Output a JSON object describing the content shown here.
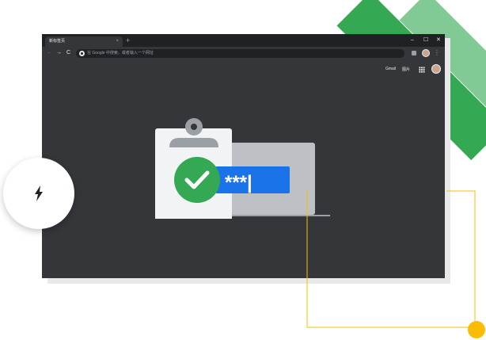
{
  "browser": {
    "tab_title": "新标签页",
    "tab_close_glyph": "×",
    "new_tab_glyph": "+",
    "window_controls": {
      "minimize": "–",
      "maximize": "☐",
      "close": "✕"
    },
    "nav": {
      "back": "←",
      "forward": "→",
      "reload": "C"
    },
    "omnibox_placeholder": "在 Google 中搜索，或者输入一个网址",
    "menu_glyph": "⋮"
  },
  "ntp": {
    "gmail_label": "Gmail",
    "images_label": "图片"
  },
  "illustration": {
    "password_mask": "***|",
    "check_glyph": "✓"
  },
  "colors": {
    "window_bg": "#35363a",
    "tab_strip": "#202124",
    "google_blue": "#1a73e8",
    "google_green": "#34a853",
    "light_green": "#81c995",
    "google_yellow": "#fbbc04"
  },
  "icons": [
    "bolt-icon",
    "apps-grid-icon",
    "avatar-icon",
    "google-g-icon",
    "extension-icon",
    "checkmark-icon",
    "clipboard-icon",
    "laptop-icon"
  ]
}
